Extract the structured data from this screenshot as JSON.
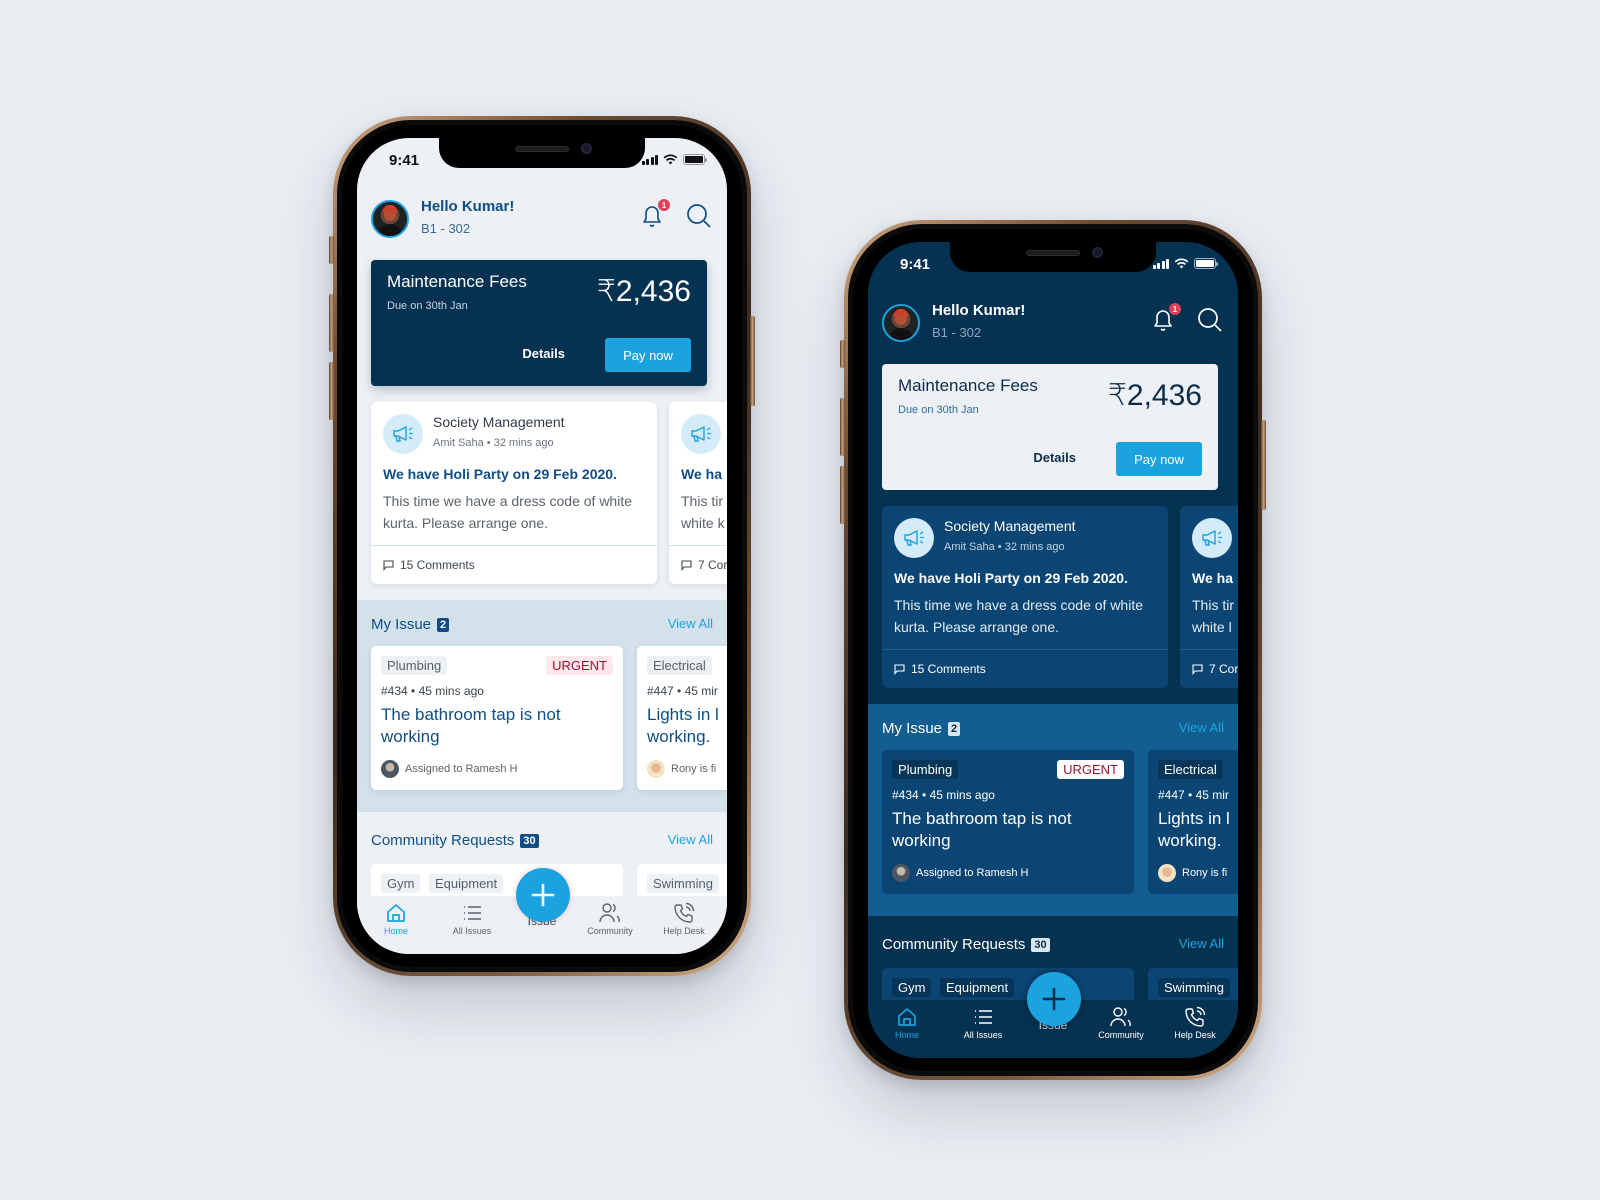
{
  "phones": [
    {
      "theme": "light",
      "status": {
        "time": "9:41"
      },
      "header": {
        "greeting": "Hello Kumar!",
        "unit": "B1 - 302",
        "notification_count": "1"
      },
      "fees": {
        "title": "Maintenance Fees",
        "due": "Due on 30th Jan",
        "amount": "₹2,436",
        "details_label": "Details",
        "pay_label": "Pay now"
      },
      "notices": [
        {
          "source": "Society Management",
          "meta": "Amit Saha • 32 mins ago",
          "headline": "We have Holi Party on 29 Feb 2020.",
          "body": "This time we have a dress code of white kurta. Please arrange one.",
          "comments": "15 Comments"
        },
        {
          "source": "",
          "meta": "",
          "headline": "We ha",
          "body": "This tir white k",
          "comments": "7 Cor"
        }
      ],
      "my_issue": {
        "title": "My Issue",
        "count": "2",
        "view_all": "View All",
        "items": [
          {
            "category": "Plumbing",
            "priority": "URGENT",
            "meta": "#434 • 45 mins ago",
            "title": "The bathroom tap is not working",
            "assignee": "Assigned to Ramesh H"
          },
          {
            "category": "Electrical",
            "priority": "",
            "meta": "#447 • 45 mir",
            "title": "Lights in l working.",
            "assignee": "Rony is fi"
          }
        ]
      },
      "community": {
        "title": "Community Requests",
        "count": "30",
        "view_all": "View All",
        "items": [
          {
            "tags": [
              "Gym",
              "Equipment"
            ]
          },
          {
            "tags": [
              "Swimming"
            ]
          }
        ]
      },
      "tabbar": {
        "items": [
          {
            "label": "Home",
            "icon": "home-icon",
            "active": true
          },
          {
            "label": "All Issues",
            "icon": "list-icon",
            "active": false
          },
          {
            "label": "Community",
            "icon": "people-icon",
            "active": false
          },
          {
            "label": "Help Desk",
            "icon": "phone-icon",
            "active": false
          }
        ],
        "fab_hidden_label": "Issue"
      }
    },
    {
      "theme": "dark",
      "status": {
        "time": "9:41"
      },
      "header": {
        "greeting": "Hello Kumar!",
        "unit": "B1 - 302",
        "notification_count": "1"
      },
      "fees": {
        "title": "Maintenance Fees",
        "due": "Due on 30th Jan",
        "amount": "₹2,436",
        "details_label": "Details",
        "pay_label": "Pay now"
      },
      "notices": [
        {
          "source": "Society Management",
          "meta": "Amit Saha • 32 mins ago",
          "headline": "We have Holi Party on 29 Feb 2020.",
          "body": "This time we have a dress code of white kurta. Please arrange one.",
          "comments": "15 Comments"
        },
        {
          "source": "",
          "meta": "",
          "headline": "We ha",
          "body": "This tir white l",
          "comments": "7 Cor"
        }
      ],
      "my_issue": {
        "title": "My Issue",
        "count": "2",
        "view_all": "View All",
        "items": [
          {
            "category": "Plumbing",
            "priority": "URGENT",
            "meta": "#434 • 45 mins ago",
            "title": "The bathroom tap is not working",
            "assignee": "Assigned to Ramesh H"
          },
          {
            "category": "Electrical",
            "priority": "",
            "meta": "#447 • 45 mir",
            "title": "Lights in l working.",
            "assignee": "Rony is fi"
          }
        ]
      },
      "community": {
        "title": "Community Requests",
        "count": "30",
        "view_all": "View All",
        "items": [
          {
            "tags": [
              "Gym",
              "Equipment"
            ]
          },
          {
            "tags": [
              "Swimming"
            ]
          }
        ]
      },
      "tabbar": {
        "items": [
          {
            "label": "Home",
            "icon": "home-icon",
            "active": true
          },
          {
            "label": "All Issues",
            "icon": "list-icon",
            "active": false
          },
          {
            "label": "Community",
            "icon": "people-icon",
            "active": false
          },
          {
            "label": "Help Desk",
            "icon": "phone-icon",
            "active": false
          }
        ],
        "fab_hidden_label": "Issue"
      }
    }
  ],
  "colors": {
    "accent": "#1ba3e0",
    "navy": "#063252",
    "urgent": "#a0122e",
    "badge": "#e0405a",
    "background": "#e9eef3"
  }
}
